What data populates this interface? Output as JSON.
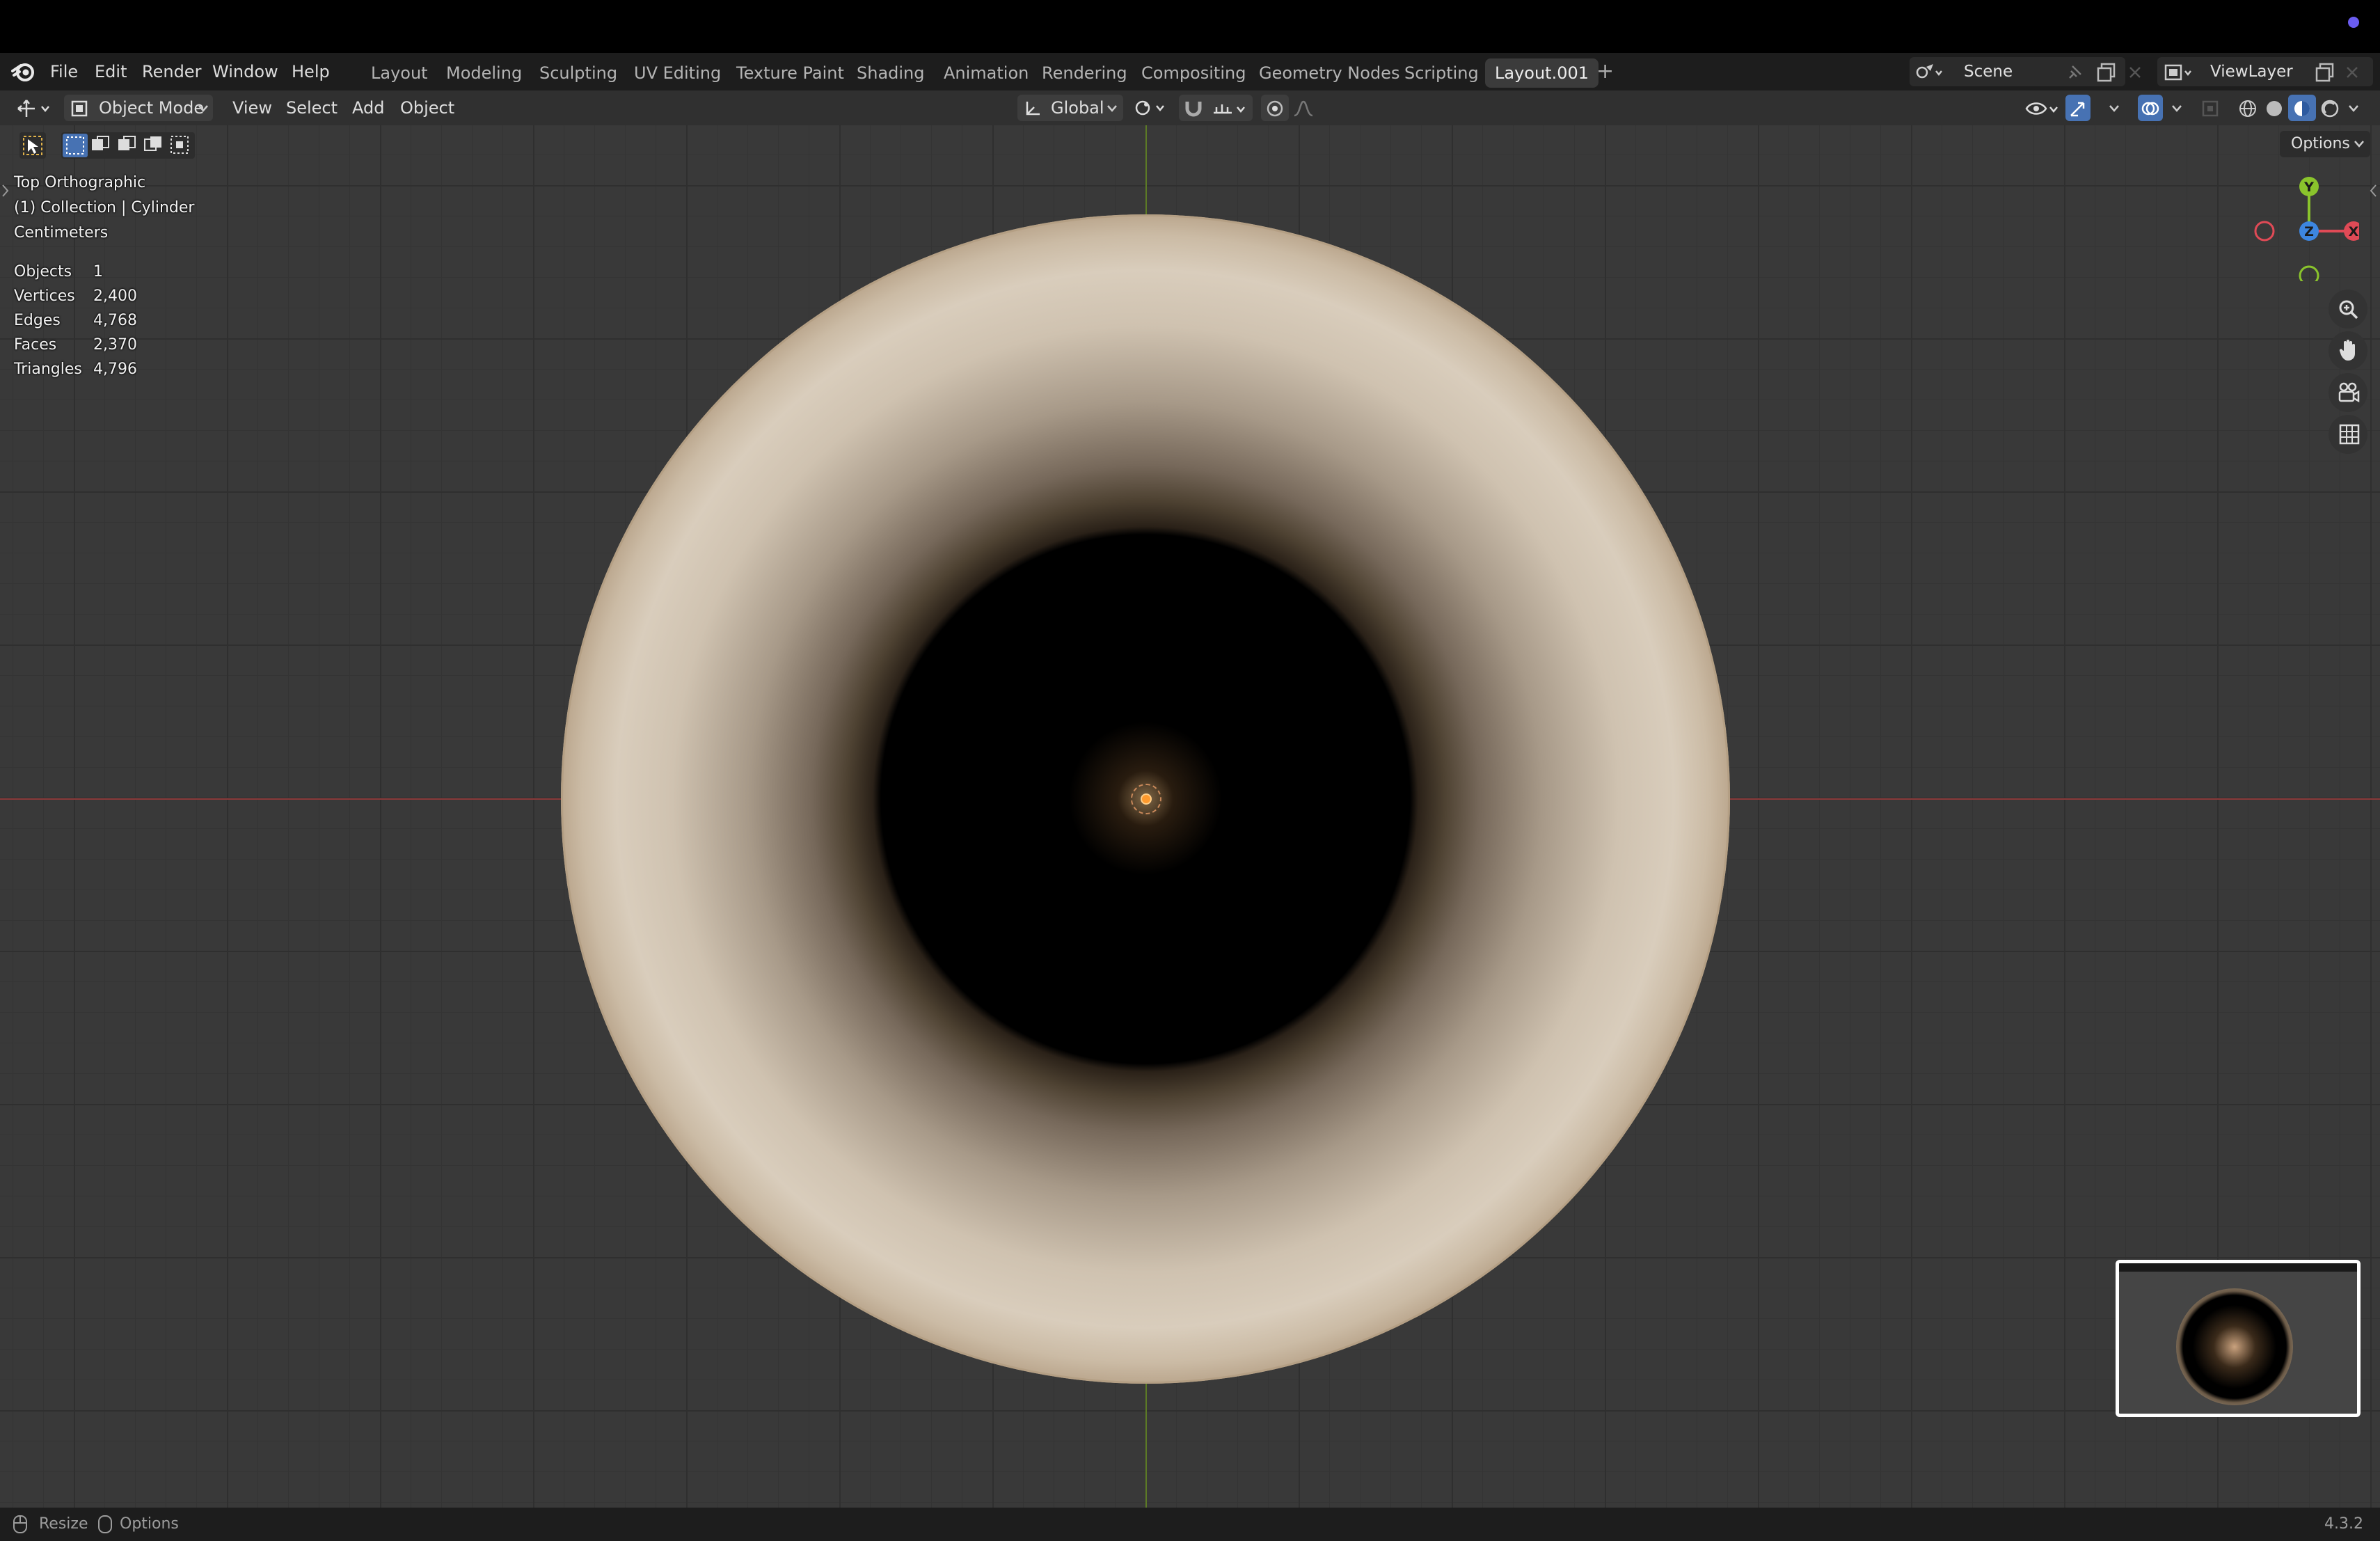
{
  "app": {
    "name": "Blender",
    "version": "4.3.2"
  },
  "menu": {
    "items": [
      "File",
      "Edit",
      "Render",
      "Window",
      "Help"
    ]
  },
  "workspaces": {
    "tabs": [
      "Layout",
      "Modeling",
      "Sculpting",
      "UV Editing",
      "Texture Paint",
      "Shading",
      "Animation",
      "Rendering",
      "Compositing",
      "Geometry Nodes",
      "Scripting",
      "Layout.001"
    ],
    "active": "Layout.001",
    "add_label": "+"
  },
  "scene": {
    "name": "Scene"
  },
  "view_layer": {
    "name": "ViewLayer"
  },
  "header": {
    "mode": "Object Mode",
    "menus": [
      "View",
      "Select",
      "Add",
      "Object"
    ],
    "transform_orientation": "Global",
    "options_label": "Options"
  },
  "viewport": {
    "view_name": "Top Orthographic",
    "collection_info": "(1) Collection | Cylinder",
    "units": "Centimeters",
    "stats": [
      {
        "label": "Objects",
        "value": "1"
      },
      {
        "label": "Vertices",
        "value": "2,400"
      },
      {
        "label": "Edges",
        "value": "4,768"
      },
      {
        "label": "Faces",
        "value": "2,370"
      },
      {
        "label": "Triangles",
        "value": "4,796"
      }
    ],
    "gizmo": {
      "y": "Y",
      "x": "X",
      "z": "Z"
    }
  },
  "status": {
    "resize_label": "Resize",
    "options_label": "Options"
  },
  "colors": {
    "accent": "#4772b3",
    "axis_x": "#e04a56",
    "axis_y": "#8ac42c",
    "axis_z": "#3d86e0",
    "origin": "#ff9a2e"
  }
}
